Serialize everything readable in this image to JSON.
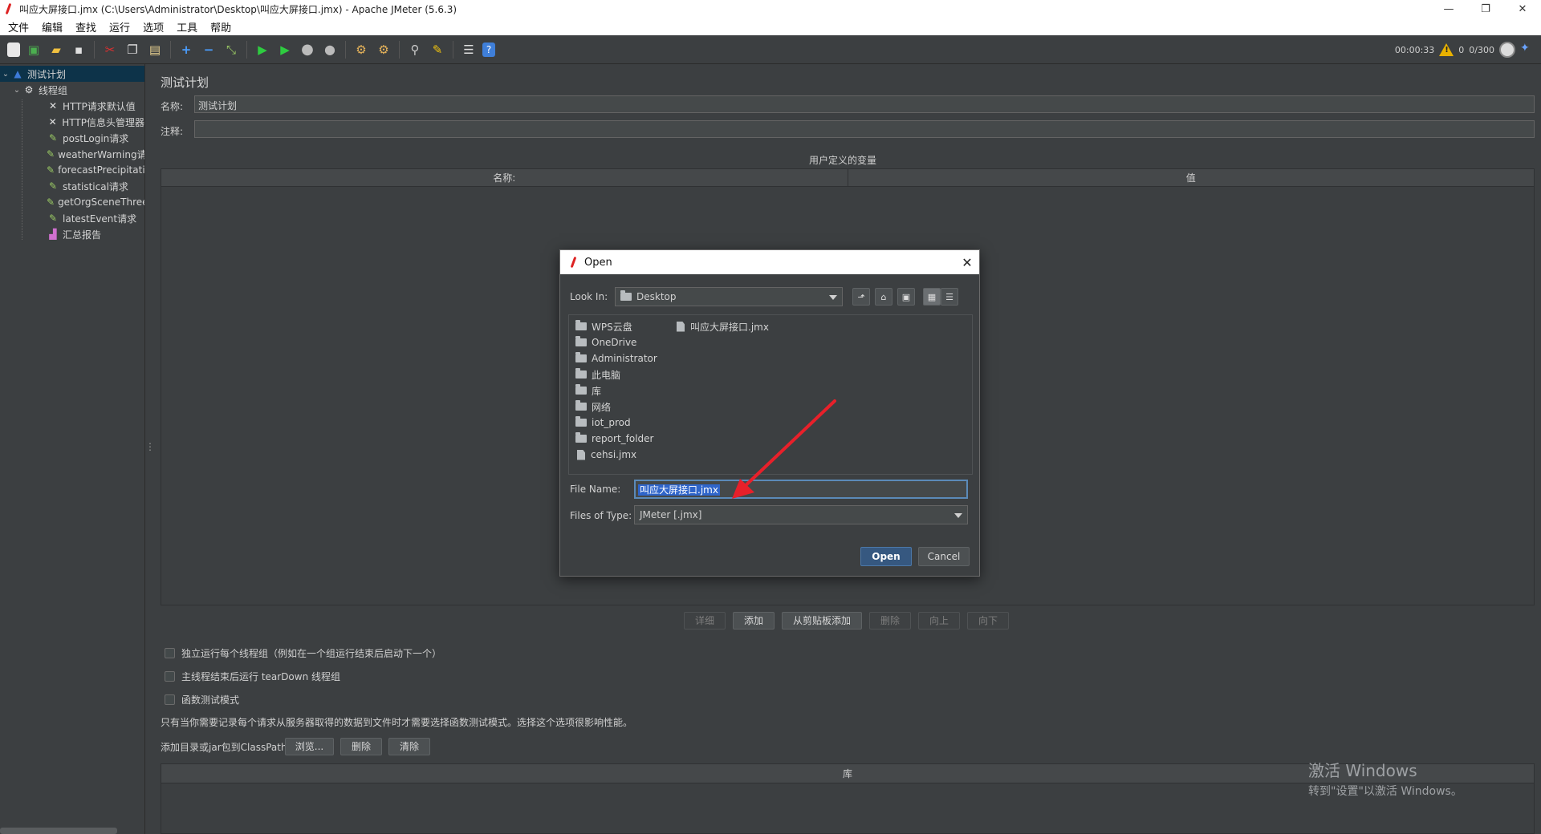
{
  "window": {
    "title": "叫应大屏接口.jmx (C:\\Users\\Administrator\\Desktop\\叫应大屏接口.jmx) - Apache JMeter (5.6.3)",
    "minimize": "—",
    "restore": "❐",
    "close": "✕"
  },
  "menu": [
    "文件",
    "编辑",
    "查找",
    "运行",
    "选项",
    "工具",
    "帮助"
  ],
  "toolbar": {
    "timer": "00:00:33",
    "warnings": "0",
    "threads": "0/300"
  },
  "tree": {
    "items": [
      {
        "label": "测试计划",
        "icon": "test-plan-icon",
        "level": 0
      },
      {
        "label": "线程组",
        "icon": "gear-icon",
        "level": 1
      },
      {
        "label": "HTTP请求默认值",
        "icon": "wrench-icon",
        "level": 2
      },
      {
        "label": "HTTP信息头管理器",
        "icon": "wrench-icon",
        "level": 2
      },
      {
        "label": "postLogin请求",
        "icon": "sampler-pen-icon",
        "level": 2
      },
      {
        "label": "weatherWarning请",
        "icon": "sampler-pen-icon",
        "level": 2
      },
      {
        "label": "forecastPrecipitati",
        "icon": "sampler-pen-icon",
        "level": 2
      },
      {
        "label": "statistical请求",
        "icon": "sampler-pen-icon",
        "level": 2
      },
      {
        "label": "getOrgSceneThree",
        "icon": "sampler-pen-icon",
        "level": 2
      },
      {
        "label": "latestEvent请求",
        "icon": "sampler-pen-icon",
        "level": 2
      },
      {
        "label": "汇总报告",
        "icon": "report-chart-icon",
        "level": 2
      }
    ]
  },
  "main": {
    "title": "测试计划",
    "name_label": "名称:",
    "name_value": "测试计划",
    "comment_label": "注释:",
    "comment_value": "",
    "uv_caption": "用户定义的变量",
    "uv_columns": [
      "名称:",
      "值"
    ],
    "buttons": {
      "detail": "详细",
      "add": "添加",
      "add_clipboard": "从剪贴板添加",
      "delete": "删除",
      "up": "向上",
      "down": "向下"
    },
    "checks": [
      "独立运行每个线程组（例如在一个组运行结束后启动下一个）",
      "主线程结束后运行 tearDown 线程组",
      "函数测试模式"
    ],
    "note": "只有当你需要记录每个请求从服务器取得的数据到文件时才需要选择函数测试模式。选择这个选项很影响性能。",
    "classpath_label": "添加目录或jar包到ClassPath",
    "cp_buttons": {
      "browse": "浏览...",
      "delete": "删除",
      "clear": "清除"
    },
    "lib_header": "库"
  },
  "watermark": {
    "line1": "激活 Windows",
    "line2": "转到\"设置\"以激活 Windows。"
  },
  "dialog": {
    "title": "Open",
    "close": "✕",
    "look_in_label": "Look In:",
    "look_in_value": "Desktop",
    "files_col1": [
      {
        "name": "WPS云盘",
        "type": "folder"
      },
      {
        "name": "OneDrive",
        "type": "folder"
      },
      {
        "name": "Administrator",
        "type": "folder"
      },
      {
        "name": "此电脑",
        "type": "folder"
      },
      {
        "name": "库",
        "type": "folder"
      },
      {
        "name": "网络",
        "type": "folder"
      },
      {
        "name": "iot_prod",
        "type": "folder"
      },
      {
        "name": "report_folder",
        "type": "folder"
      },
      {
        "name": "cehsi.jmx",
        "type": "file"
      }
    ],
    "files_col2": [
      {
        "name": "叫应大屏接口.jmx",
        "type": "file"
      }
    ],
    "file_name_label": "File Name:",
    "file_name_value": "叫应大屏接口.jmx",
    "files_of_type_label": "Files of Type:",
    "files_of_type_value": "JMeter [.jmx]",
    "open_button": "Open",
    "cancel_button": "Cancel"
  },
  "colors": {
    "background": "#3c3f41",
    "selection": "#0d3349",
    "primary_button": "#365880",
    "annotation_arrow": "#e8202a"
  }
}
